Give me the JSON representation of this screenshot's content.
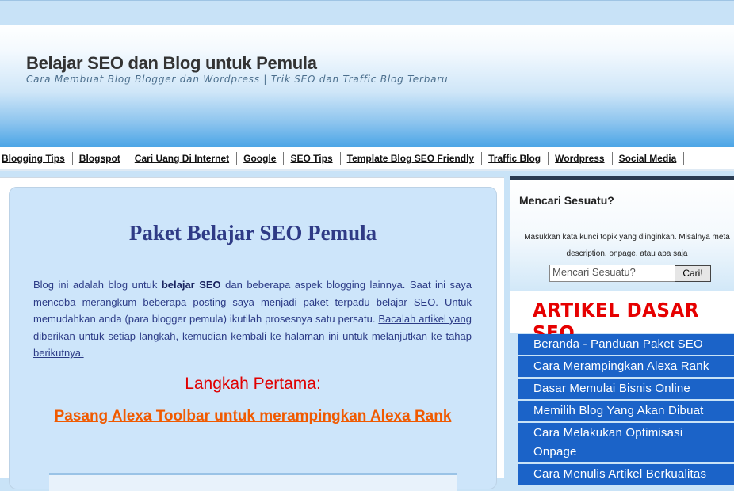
{
  "header": {
    "title": "Belajar SEO dan Blog untuk Pemula",
    "description": "Cara Membuat Blog Blogger dan Wordpress | Trik SEO dan Traffic Blog Terbaru"
  },
  "nav": {
    "items": [
      "Blogging Tips",
      "Blogspot",
      "Cari Uang Di Internet",
      "Google",
      "SEO Tips",
      "Template Blog SEO Friendly",
      "Traffic Blog",
      "Wordpress",
      "Social Media"
    ]
  },
  "post": {
    "title": "Paket Belajar SEO Pemula",
    "intro_prefix": "Blog ini adalah blog untuk ",
    "intro_bold": "belajar SEO",
    "intro_rest": " dan beberapa aspek blogging lainnya. Saat ini saya mencoba merangkum beberapa posting saya menjadi paket terpadu belajar SEO. Untuk memudahkan anda (para blogger pemula) ikutilah prosesnya satu persatu. ",
    "intro_underlined": "Bacalah artikel yang diberikan untuk setiap langkah, kemudian kembali ke halaman ini untuk melanjutkan ke tahap berikutnya.",
    "step_title": "Langkah Pertama:",
    "step_link": "Pasang Alexa Toolbar untuk merampingkan Alexa Rank"
  },
  "sidebar": {
    "search_heading": "Mencari Sesuatu?",
    "search_note_line1": "Masukkan kata kunci topik yang diinginkan. Misalnya meta",
    "search_note_line2": "description, onpage, atau apa saja",
    "search_placeholder": "Mencari Sesuatu?",
    "search_button": "Cari!",
    "banner": "ARTIKEL DASAR SEO",
    "links": [
      "Beranda - Panduan Paket SEO",
      "Cara Merampingkan Alexa Rank",
      "Dasar Memulai Bisnis Online",
      "Memilih Blog Yang Akan Dibuat",
      "Cara Melakukan Optimisasi Onpage",
      "Cara Menulis Artikel Berkualitas"
    ]
  },
  "colors": {
    "link_bg": "#1b63c8",
    "banner_red": "#e60000",
    "post_title": "#2f3b86",
    "step_red": "#e00000",
    "step_link_orange": "#f05a00"
  }
}
